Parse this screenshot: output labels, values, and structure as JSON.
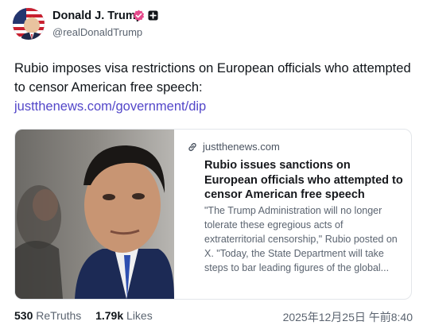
{
  "author": {
    "name": "Donald J. Trump",
    "handle": "@realDonaldTrump",
    "verified_color": "#e64a8c",
    "avatar_icon": "flag-portrait-avatar"
  },
  "post": {
    "text": "Rubio imposes visa restrictions on European officials who attempted to censor American free speech:",
    "link": "justthenews.com/government/dip",
    "link_color": "#5347c9"
  },
  "card": {
    "domain": "justthenews.com",
    "title": "Rubio issues sanctions on European officials who attempted to censor American free speech",
    "description": "\"The Trump Administration will no longer tolerate these egregious acts of extraterritorial censorship,\" Rubio posted on X. \"Today, the State Department will take steps to bar leading figures of the global...",
    "image_icon": "news-photo"
  },
  "footer": {
    "retruths_count": "530",
    "retruths_label": "ReTruths",
    "likes_count": "1.79k",
    "likes_label": "Likes",
    "timestamp": "2025年12月25日 午前8:40"
  }
}
